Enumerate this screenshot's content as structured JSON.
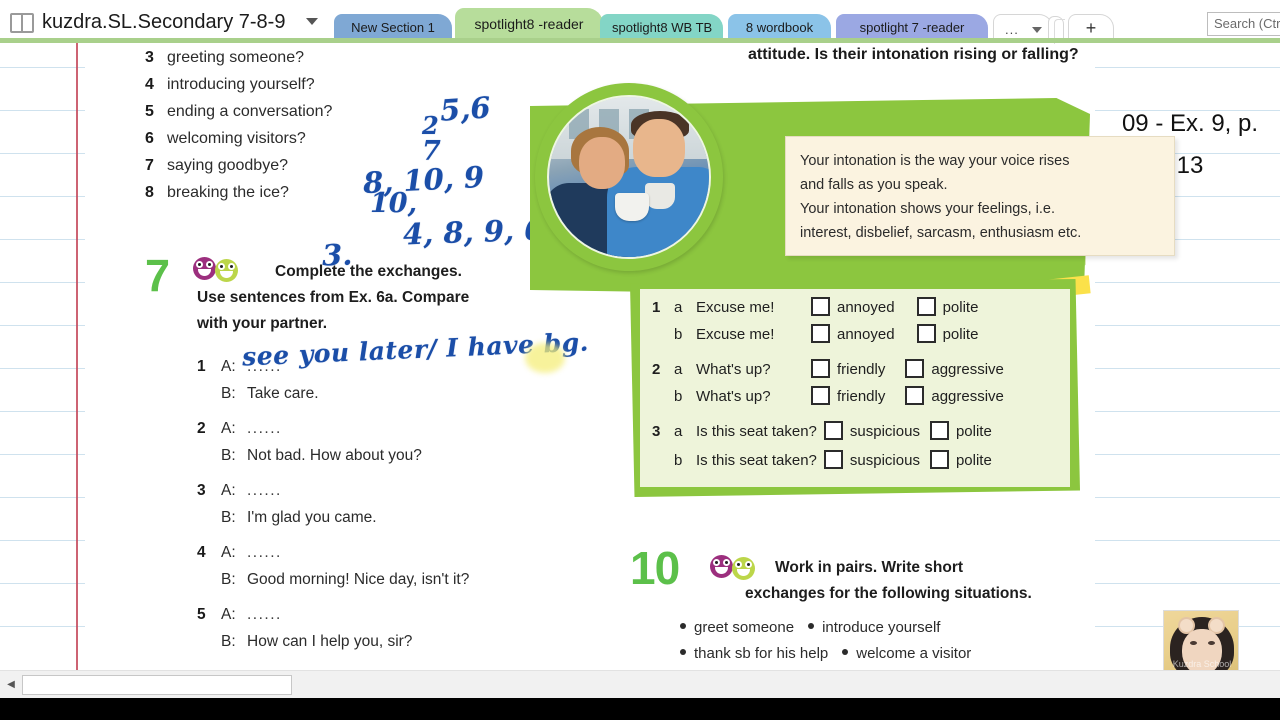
{
  "window": {
    "notebook_title": "kuzdra.SL.Secondary 7-8-9",
    "notebook_icon": "notebook-icon",
    "caret_icon": "chevron-down-icon"
  },
  "tabs": {
    "items": [
      {
        "label": "New Section 1",
        "color": "#7fa8d4",
        "selected": false
      },
      {
        "label": "spotlight8 -reader",
        "color": "#b7dd9b",
        "selected": true
      },
      {
        "label": "spotlight8 WB TB",
        "color": "#83d5c6",
        "selected": false
      },
      {
        "label": "8 wordbook",
        "color": "#8bc3e8",
        "selected": false
      },
      {
        "label": "spotlight 7 -reader",
        "color": "#9ba8e3",
        "selected": false
      }
    ],
    "overflow_label": "...",
    "overflow_caret_icon": "chevron-down-icon",
    "add_label": "+"
  },
  "search": {
    "placeholder": "Search (Ctrl",
    "value": "Search (Ctrl"
  },
  "note": {
    "right_line1": "09 - Ex. 9, p.",
    "right_line2": "13"
  },
  "avatar": {
    "watermark": "Kuzdra School"
  },
  "scan": {
    "question_list": [
      {
        "num": "3",
        "text": "greeting someone?"
      },
      {
        "num": "4",
        "text": "introducing yourself?"
      },
      {
        "num": "5",
        "text": "ending a conversation?"
      },
      {
        "num": "6",
        "text": "welcoming visitors?"
      },
      {
        "num": "7",
        "text": "saying goodbye?"
      },
      {
        "num": "8",
        "text": "breaking the ice?"
      }
    ],
    "handwriting": {
      "a": "5,6",
      "b": "2",
      "c": "7",
      "d": "8, 10, 9",
      "e": "10,",
      "f": "4, 8, 9, 6",
      "g": "3.",
      "answer1": "see you later/ I have bg."
    },
    "attitude_line": "attitude. Is their intonation rising or falling?",
    "tip_box": [
      "Your intonation is the way your voice rises",
      "and falls as you speak.",
      "Your intonation shows your feelings, i.e.",
      "interest, disbelief, sarcasm, enthusiasm etc."
    ],
    "exercise7": {
      "number": "7",
      "heading_line1": "Complete the exchanges.",
      "heading_line2": "Use sentences from Ex. 6a. Compare",
      "heading_line3": "with your partner.",
      "items": [
        {
          "num": "1",
          "a_label": "A:",
          "a_dots": "......",
          "b_label": "B:",
          "b_text": "Take care."
        },
        {
          "num": "2",
          "a_label": "A:",
          "a_dots": "......",
          "b_label": "B:",
          "b_text": "Not bad. How about you?"
        },
        {
          "num": "3",
          "a_label": "A:",
          "a_dots": "......",
          "b_label": "B:",
          "b_text": "I'm glad you came."
        },
        {
          "num": "4",
          "a_label": "A:",
          "a_dots": "......",
          "b_label": "B:",
          "b_text": "Good morning! Nice day, isn't it?"
        },
        {
          "num": "5",
          "a_label": "A:",
          "a_dots": "......",
          "b_label": "B:",
          "b_text": "How can I help you, sir?"
        }
      ]
    },
    "checkbox_exercise": {
      "rows": [
        {
          "num": "1",
          "let": "a",
          "phrase": "Excuse me!",
          "opt1": "annoyed",
          "opt2": "polite"
        },
        {
          "num": "",
          "let": "b",
          "phrase": "Excuse me!",
          "opt1": "annoyed",
          "opt2": "polite"
        },
        {
          "num": "2",
          "let": "a",
          "phrase": "What's up?",
          "opt1": "friendly",
          "opt2": "aggressive"
        },
        {
          "num": "",
          "let": "b",
          "phrase": "What's up?",
          "opt1": "friendly",
          "opt2": "aggressive"
        },
        {
          "num": "3",
          "let": "a",
          "phrase": "Is this seat taken?",
          "opt1": "suspicious",
          "opt2": "polite"
        },
        {
          "num": "",
          "let": "b",
          "phrase": "Is this seat taken?",
          "opt1": "suspicious",
          "opt2": "polite"
        }
      ]
    },
    "exercise10": {
      "number": "10",
      "heading_line1": "Work in pairs. Write short",
      "heading_line2": "exchanges for the following situations.",
      "bullets_row1": [
        "greet someone",
        "introduce yourself"
      ],
      "bullets_row2": [
        "thank sb for his help",
        "welcome a visitor"
      ]
    }
  },
  "colors": {
    "brand_green": "#8cc63f",
    "number_green": "#5cc04a",
    "ink_blue": "#1b4ea8",
    "rule_blue": "#cfe2ee",
    "margin_red": "#c4485a"
  }
}
